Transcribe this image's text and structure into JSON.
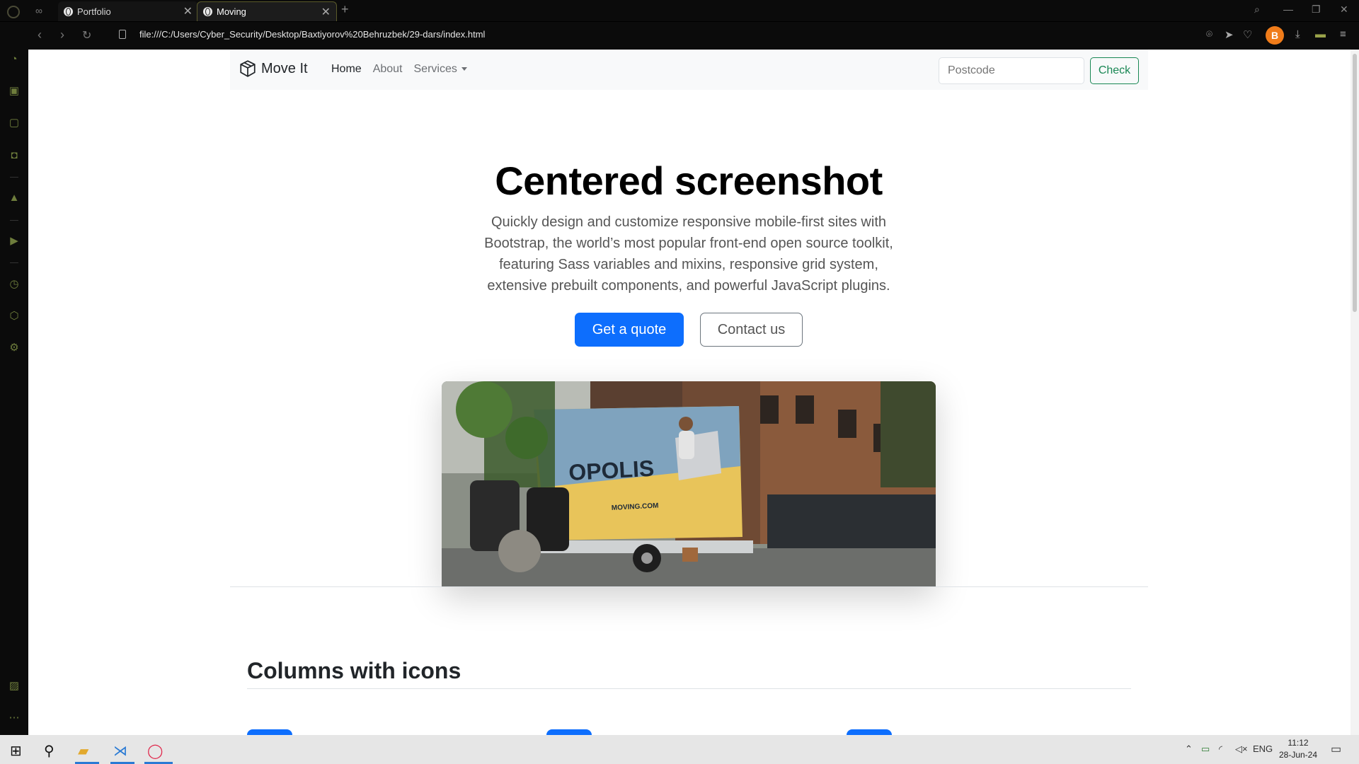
{
  "browser": {
    "tabs": [
      {
        "title": "Portfolio",
        "active": false
      },
      {
        "title": "Moving",
        "active": true
      }
    ],
    "url": "file:///C:/Users/Cyber_Security/Desktop/Baxtiyorov%20Behruzbek/29-dars/index.html",
    "avatar_letter": "B"
  },
  "page": {
    "brand": "Move It",
    "nav": [
      {
        "label": "Home",
        "active": true
      },
      {
        "label": "About",
        "active": false
      },
      {
        "label": "Services",
        "active": false
      }
    ],
    "postcode_placeholder": "Postcode",
    "check_label": "Check",
    "hero": {
      "title": "Centered screenshot",
      "lead": "Quickly design and customize responsive mobile-first sites with Bootstrap, the world’s most popular front-end open source toolkit, featuring Sass variables and mixins, responsive grid system, extensive prebuilt components, and powerful JavaScript plugins.",
      "primary_button": "Get a quote",
      "secondary_button": "Contact us",
      "truck_text": "OPOLIS",
      "truck_web": "MOVING.COM"
    },
    "section_title": "Columns with icons"
  },
  "taskbar": {
    "lang": "ENG",
    "time": "11:12",
    "date": "28-Jun-24"
  },
  "colors": {
    "primary": "#0d6efd",
    "success": "#198754",
    "opera_accent": "#6e7d3c"
  }
}
